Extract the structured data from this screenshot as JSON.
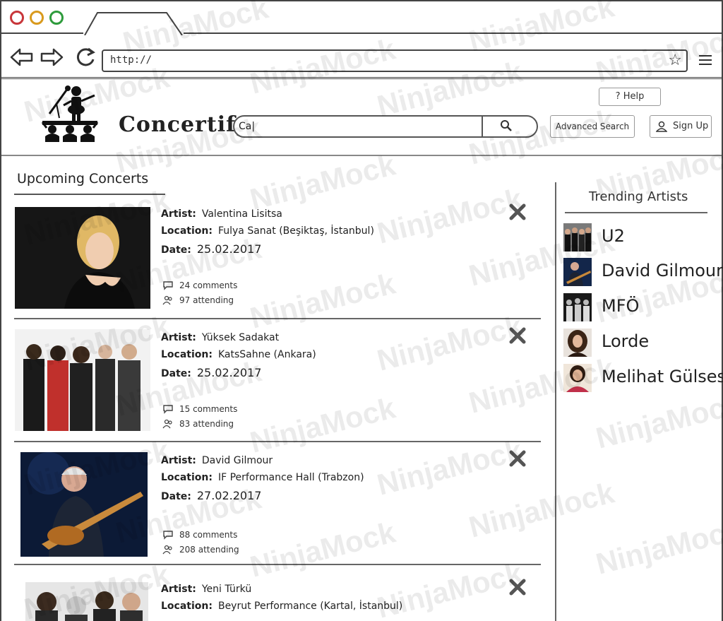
{
  "browser": {
    "address": "http://",
    "icons": [
      "back-arrow-icon",
      "forward-arrow-icon",
      "reload-icon",
      "star-icon",
      "hamburger-menu-icon"
    ]
  },
  "header": {
    "brand": "Concertify",
    "help_label": "Help",
    "search_value": "Ca|",
    "advanced_search_label": "Advanced Search",
    "signup_label": "Sign Up"
  },
  "main": {
    "section_title": "Upcoming Concerts",
    "artist_label": "Artist:",
    "location_label": "Location:",
    "date_label": "Date:",
    "concerts": [
      {
        "artist": "Valentina Lisitsa",
        "location": "Fulya Sanat (Beşiktaş, İstanbul)",
        "date": "25.02.2017",
        "comments": "24 comments",
        "attending": "97 attending"
      },
      {
        "artist": "Yüksek Sadakat",
        "location": "KatsSahne (Ankara)",
        "date": "25.02.2017",
        "comments": "15 comments",
        "attending": "83 attending"
      },
      {
        "artist": "David Gilmour",
        "location": "IF Performance Hall (Trabzon)",
        "date": "27.02.2017",
        "comments": "88 comments",
        "attending": "208 attending"
      },
      {
        "artist": "Yeni Türkü",
        "location": "Beyrut Performance (Kartal, İstanbul)",
        "date": "",
        "comments": "",
        "attending": ""
      }
    ]
  },
  "sidebar": {
    "title": "Trending Artists",
    "artists": [
      "U2",
      "David Gilmour",
      "MFÖ",
      "Lorde",
      "Melihat Gülses"
    ]
  },
  "watermark": "NinjaMock"
}
